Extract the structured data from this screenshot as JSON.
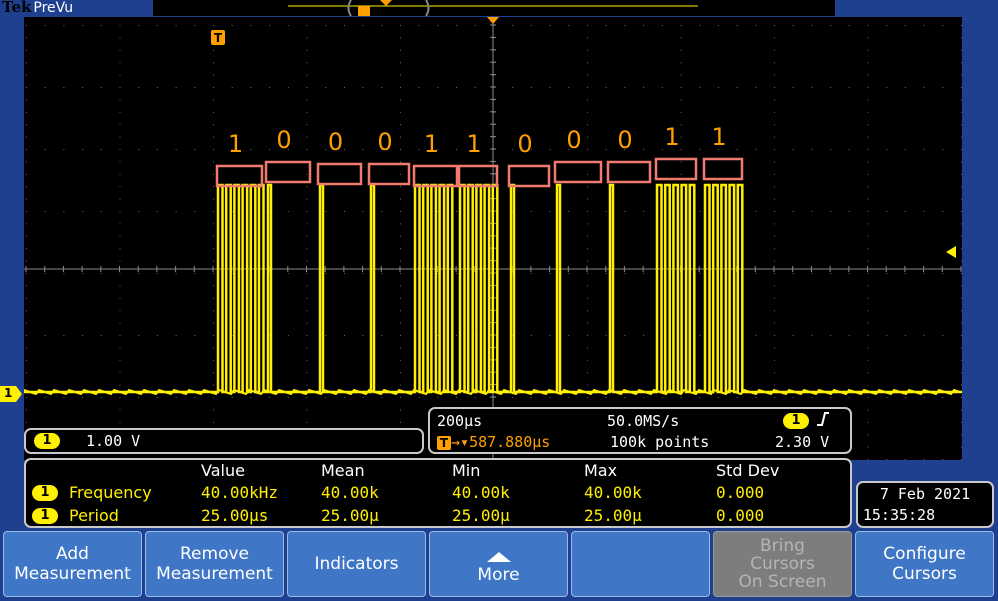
{
  "brand": {
    "tek": "Tek",
    "mode": "PreVu"
  },
  "bit_labels": [
    "1",
    "0",
    "0",
    "0",
    "1",
    "1",
    "0",
    "0",
    "0",
    "1",
    "1"
  ],
  "channel": {
    "badge": "1",
    "scale": "1.00 V"
  },
  "timebase": {
    "horizontal_scale": "200µs",
    "sample_rate": "50.0MS/s",
    "trigger_position": "587.880µs",
    "trigger_icon": "T",
    "record_length": "100k points",
    "trigger_channel": "1",
    "trigger_slope_icon": "rising-edge-icon",
    "trigger_level": "2.30 V"
  },
  "measurements": {
    "headers": [
      "Value",
      "Mean",
      "Min",
      "Max",
      "Std Dev"
    ],
    "rows": [
      {
        "ch": "1",
        "name": "Frequency",
        "value": "40.00kHz",
        "mean": "40.00k",
        "min": "40.00k",
        "max": "40.00k",
        "std": "0.000"
      },
      {
        "ch": "1",
        "name": "Period",
        "value": "25.00µs",
        "mean": "25.00µ",
        "min": "25.00µ",
        "max": "25.00µ",
        "std": "0.000"
      }
    ]
  },
  "datetime": {
    "date": "7 Feb  2021",
    "time": "15:35:28"
  },
  "buttons": [
    {
      "label": "Add\nMeasurement"
    },
    {
      "label": "Remove\nMeasurement"
    },
    {
      "label": "Indicators"
    },
    {
      "label": "More"
    },
    {
      "label": ""
    },
    {
      "label": "Bring\nCursors\nOn Screen"
    },
    {
      "label": "Configure\nCursors"
    }
  ],
  "markers": {
    "trigger": "T",
    "ch1_ground": "1"
  },
  "colors": {
    "trace": "#ffef00",
    "trigger": "#ff9f00",
    "bit_box": "#f07b6e",
    "background": "#1f3f8f",
    "button": "#3f76c6"
  }
}
